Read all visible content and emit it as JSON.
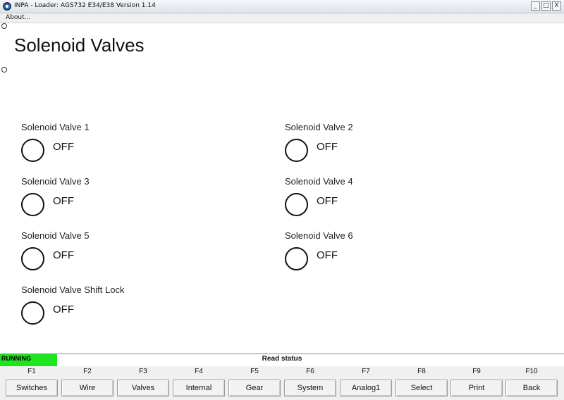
{
  "window": {
    "title": "INPA - Loader:  AGS732 E34/E38 Version 1.14",
    "minimize_glyph": "_",
    "maximize_glyph": "□",
    "close_glyph": "X"
  },
  "menu": {
    "about": "About..."
  },
  "page": {
    "title": "Solenoid Valves"
  },
  "valves": [
    {
      "label": "Solenoid Valve 1",
      "state": "OFF"
    },
    {
      "label": "Solenoid Valve 2",
      "state": "OFF"
    },
    {
      "label": "Solenoid Valve 3",
      "state": "OFF"
    },
    {
      "label": "Solenoid Valve 4",
      "state": "OFF"
    },
    {
      "label": "Solenoid Valve 5",
      "state": "OFF"
    },
    {
      "label": "Solenoid Valve 6",
      "state": "OFF"
    },
    {
      "label": "Solenoid Valve Shift Lock",
      "state": "OFF"
    }
  ],
  "status": {
    "running": "RUNNING",
    "running_color": "#1ee61e",
    "message": "Read status"
  },
  "fkeys": [
    {
      "key": "F1",
      "label": "Switches"
    },
    {
      "key": "F2",
      "label": "Wire"
    },
    {
      "key": "F3",
      "label": "Valves"
    },
    {
      "key": "F4",
      "label": "Internal"
    },
    {
      "key": "F5",
      "label": "Gear"
    },
    {
      "key": "F6",
      "label": "System"
    },
    {
      "key": "F7",
      "label": "Analog1"
    },
    {
      "key": "F8",
      "label": "Select"
    },
    {
      "key": "F9",
      "label": "Print"
    },
    {
      "key": "F10",
      "label": "Back"
    }
  ]
}
